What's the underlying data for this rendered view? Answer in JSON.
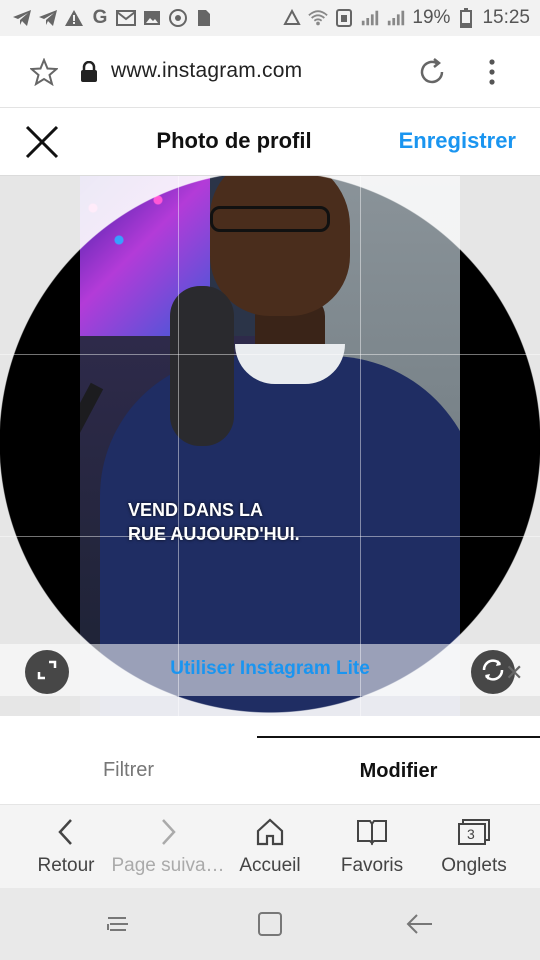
{
  "status_bar": {
    "battery_percent": "19%",
    "time": "15:25",
    "left_icons": [
      "telegram-icon",
      "telegram-icon",
      "alert-icon",
      "google-icon",
      "gmail-icon",
      "image-icon",
      "settings-circle-icon",
      "sim-icon"
    ],
    "right_icons": [
      "recycle-icon",
      "wifi-icon",
      "data-icon",
      "signal-icon",
      "signal-icon",
      "battery-icon"
    ]
  },
  "browser": {
    "url": "www.instagram.com"
  },
  "header": {
    "title": "Photo de profil",
    "save_label": "Enregistrer"
  },
  "photo": {
    "caption_line1": "VEND DANS LA",
    "caption_line2": "RUE AUJOURD'HUI."
  },
  "banner": {
    "text": "Utiliser Instagram Lite"
  },
  "tabs": [
    {
      "label": "Filtrer",
      "active": false
    },
    {
      "label": "Modifier",
      "active": true
    }
  ],
  "bottom_bar": {
    "items": [
      {
        "label": "Retour",
        "icon": "chevron-left-icon"
      },
      {
        "label": "Page suiva…",
        "icon": "chevron-right-icon"
      },
      {
        "label": "Accueil",
        "icon": "home-icon"
      },
      {
        "label": "Favoris",
        "icon": "bookmarks-icon"
      },
      {
        "label": "Onglets",
        "icon": "tabs-icon",
        "count": "3"
      }
    ]
  },
  "colors": {
    "accent": "#1a95f0",
    "status_bg": "#f2f2f2",
    "bottom_bg": "#f4f4f4"
  }
}
